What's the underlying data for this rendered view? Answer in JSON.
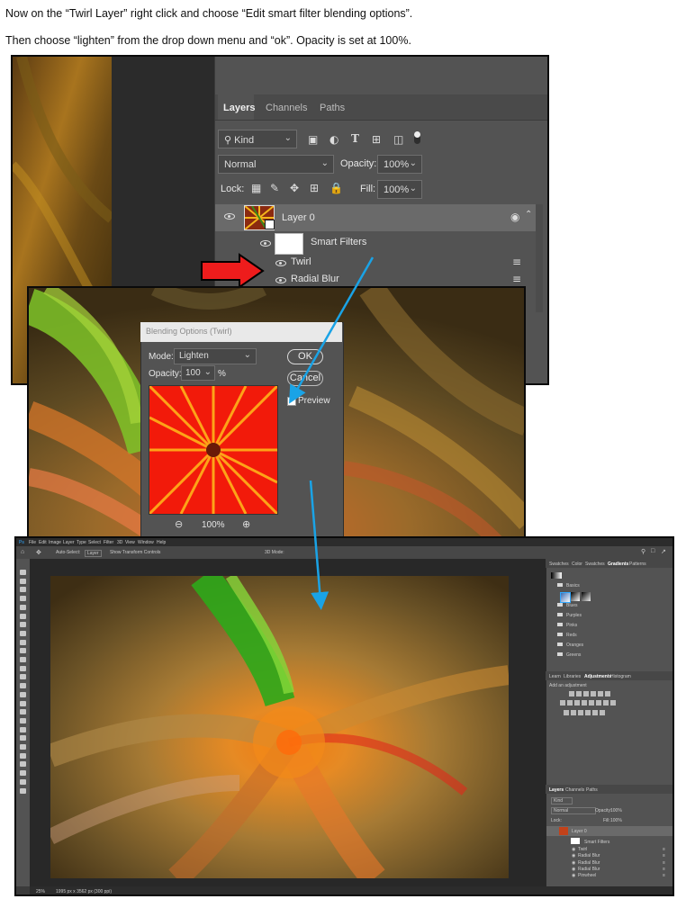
{
  "instructions": {
    "line1": "Now on the  “Twirl Layer” right click and choose “Edit smart filter blending options”.",
    "line2": "Then choose “lighten” from the drop down menu and “ok”.  Opacity is set at 100%."
  },
  "layers_panel": {
    "tabs": [
      "Layers",
      "Channels",
      "Paths"
    ],
    "kind_label": "Kind",
    "blend_mode": "Normal",
    "opacity_label": "Opacity:",
    "opacity_value": "100%",
    "lock_label": "Lock:",
    "fill_label": "Fill:",
    "fill_value": "100%",
    "layer_name": "Layer 0",
    "smart_filters_label": "Smart Filters",
    "filters": [
      "Twirl",
      "Radial Blur"
    ]
  },
  "blend_dialog": {
    "title": "Blending Options (Twirl)",
    "mode_label": "Mode:",
    "mode_value": "Lighten",
    "opacity_label": "Opacity:",
    "opacity_value": "100",
    "percent": "%",
    "ok_label": "OK",
    "cancel_label": "Cancel",
    "preview_label": "Preview",
    "zoom_value": "100%"
  },
  "workspace": {
    "menu": [
      "Ps",
      "File",
      "Edit",
      "Image",
      "Layer",
      "Type",
      "Select",
      "Filter",
      "3D",
      "View",
      "Window",
      "Help"
    ],
    "options": [
      "Auto-Select:",
      "Layer",
      "Show Transform Controls",
      "3D Mode:"
    ],
    "top_tabs": [
      "Swatches",
      "Color",
      "Swatches",
      "Gradients",
      "Patterns"
    ],
    "gradient_folders": [
      "Basics",
      "Blues",
      "Purples",
      "Pinks",
      "Reds",
      "Oranges",
      "Greens"
    ],
    "mid_tabs": [
      "Learn",
      "Libraries",
      "Adjustments",
      "Histogram"
    ],
    "add_adjustment": "Add an adjustment",
    "layers_tabs": [
      "Layers",
      "Channels",
      "Paths"
    ],
    "kind_label": "Kind",
    "blend_mode": "Normal",
    "opacity_label": "Opacity:",
    "opacity_value": "100%",
    "lock_label": "Lock:",
    "fill_label": "Fill:",
    "fill_value": "100%",
    "layer_name": "Layer 0",
    "smart_filters_label": "Smart Filters",
    "filters": [
      "Twirl",
      "Radial Blur",
      "Radial Blur",
      "Radial Blur",
      "Pinwheel"
    ],
    "status_zoom": "25%",
    "status_doc": "1995 px x 3562 px (300 ppi)"
  },
  "colors": {
    "arrow_red": "#ee1c1c",
    "pointer_blue": "#1aa3e6",
    "ps_dark": "#535353"
  }
}
